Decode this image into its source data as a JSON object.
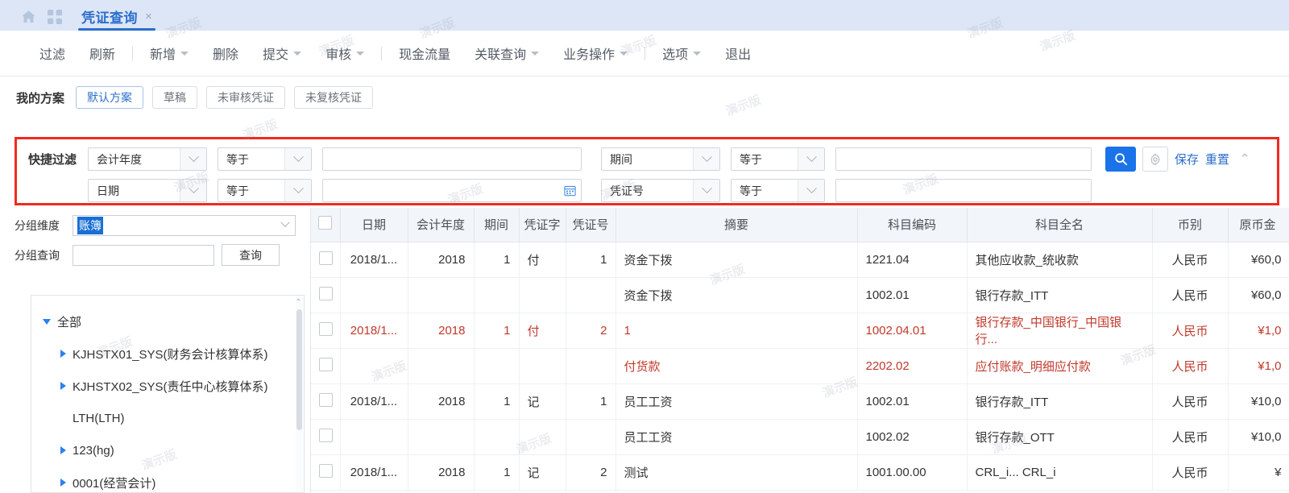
{
  "topbar": {
    "home_icon": "home-icon",
    "apps_icon": "grid-apps-icon",
    "tab_label": "凭证查询",
    "tab_close": "×"
  },
  "toolbar": {
    "items": [
      {
        "label": "过滤",
        "caret": false
      },
      {
        "label": "刷新",
        "caret": false
      },
      {
        "sep": true
      },
      {
        "label": "新增",
        "caret": true
      },
      {
        "label": "删除",
        "caret": false
      },
      {
        "label": "提交",
        "caret": true
      },
      {
        "label": "审核",
        "caret": true
      },
      {
        "sep": true
      },
      {
        "label": "现金流量",
        "caret": false
      },
      {
        "label": "关联查询",
        "caret": true
      },
      {
        "label": "业务操作",
        "caret": true
      },
      {
        "sep": true
      },
      {
        "label": "选项",
        "caret": true
      },
      {
        "label": "退出",
        "caret": false
      }
    ]
  },
  "scheme": {
    "label": "我的方案",
    "chips": [
      "默认方案",
      "草稿",
      "未审核凭证",
      "未复核凭证"
    ],
    "active_index": 0
  },
  "quick_filter": {
    "label": "快捷过滤",
    "rows": [
      {
        "field": "会计年度",
        "operator": "等于",
        "value": "",
        "field2": "期间",
        "operator2": "等于",
        "value2": "",
        "has_calendar": false
      },
      {
        "field": "日期",
        "operator": "等于",
        "value": "",
        "field2": "凭证号",
        "operator2": "等于",
        "value2": "",
        "has_calendar": true
      }
    ],
    "search_icon": "search-icon",
    "gear_icon": "gear-icon",
    "save_label": "保存",
    "reset_label": "重置",
    "collapse_icon": "chevron-up-icon",
    "outline_color": "#f02a20"
  },
  "left_panel": {
    "group_dim_label": "分组维度",
    "group_dim_value": "账簿",
    "group_query_label": "分组查询",
    "group_query_value": "",
    "query_button": "查询",
    "tree": [
      {
        "label": "全部",
        "indent": 0,
        "state": "expanded"
      },
      {
        "label": "KJHSTX01_SYS(财务会计核算体系)",
        "indent": 1,
        "state": "collapsed"
      },
      {
        "label": "KJHSTX02_SYS(责任中心核算体系)",
        "indent": 1,
        "state": "collapsed"
      },
      {
        "label": "LTH(LTH)",
        "indent": 1,
        "state": "leaf"
      },
      {
        "label": "123(hg)",
        "indent": 1,
        "state": "collapsed"
      },
      {
        "label": "0001(经营会计)",
        "indent": 1,
        "state": "collapsed"
      }
    ]
  },
  "table": {
    "columns": [
      "",
      "日期",
      "会计年度",
      "期间",
      "凭证字",
      "凭证号",
      "摘要",
      "科目编码",
      "科目全名",
      "币别",
      "原币金"
    ],
    "rows": [
      {
        "date": "2018/1...",
        "year": "2018",
        "period": "1",
        "vtype": "付",
        "vno": "1",
        "abstract": "资金下拨",
        "code": "1221.04",
        "name": "其他应收款_统收款",
        "currency": "人民币",
        "amount": "¥60,0",
        "red": false
      },
      {
        "date": "",
        "year": "",
        "period": "",
        "vtype": "",
        "vno": "",
        "abstract": "资金下拨",
        "code": "1002.01",
        "name": "银行存款_ITT",
        "currency": "人民币",
        "amount": "¥60,0",
        "red": false
      },
      {
        "date": "2018/1...",
        "year": "2018",
        "period": "1",
        "vtype": "付",
        "vno": "2",
        "abstract": "1",
        "code": "1002.04.01",
        "name": "银行存款_中国银行_中国银行...",
        "currency": "人民币",
        "amount": "¥1,0",
        "red": true
      },
      {
        "date": "",
        "year": "",
        "period": "",
        "vtype": "",
        "vno": "",
        "abstract": "付货款",
        "code": "2202.02",
        "name": "应付账款_明细应付款",
        "currency": "人民币",
        "amount": "¥1,0",
        "red": true
      },
      {
        "date": "2018/1...",
        "year": "2018",
        "period": "1",
        "vtype": "记",
        "vno": "1",
        "abstract": "员工工资",
        "code": "1002.01",
        "name": "银行存款_ITT",
        "currency": "人民币",
        "amount": "¥10,0",
        "red": false
      },
      {
        "date": "",
        "year": "",
        "period": "",
        "vtype": "",
        "vno": "",
        "abstract": "员工工资",
        "code": "1002.02",
        "name": "银行存款_OTT",
        "currency": "人民币",
        "amount": "¥10,0",
        "red": false
      },
      {
        "date": "2018/1...",
        "year": "2018",
        "period": "1",
        "vtype": "记",
        "vno": "2",
        "abstract": "测试",
        "code": "1001.00.00",
        "name": "CRL_i...      CRL_i",
        "currency": "人民币",
        "amount": "¥",
        "red": false
      }
    ]
  },
  "watermark_text": "演示版"
}
